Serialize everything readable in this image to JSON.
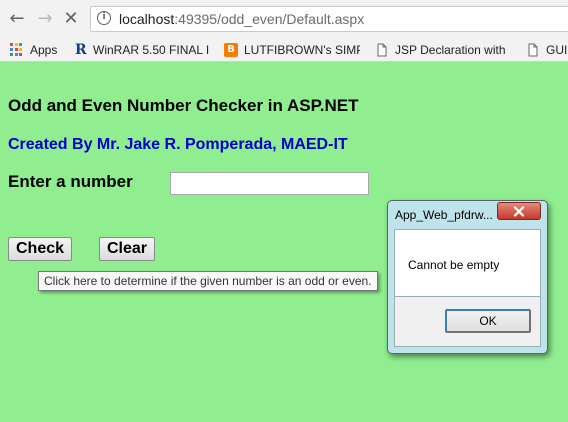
{
  "browser": {
    "url_host": "localhost",
    "url_rest": ":49395/odd_even/Default.aspx",
    "bookmarks": [
      {
        "label": "Apps"
      },
      {
        "label": "WinRAR 5.50 FINAL I"
      },
      {
        "label": "LUTFIBROWN's SIMP"
      },
      {
        "label": "JSP Declaration with"
      },
      {
        "label": "GUI"
      }
    ]
  },
  "page": {
    "title": "Odd and Even Number Checker in ASP.NET",
    "author": "Created By Mr. Jake R. Pomperada, MAED-IT",
    "input_label": "Enter a number",
    "input_value": "",
    "check_label": "Check",
    "clear_label": "Clear",
    "tooltip": "Click here to determine if the given number is an odd or even."
  },
  "dialog": {
    "title": "App_Web_pfdrw...",
    "message": "Cannot be empty",
    "ok_label": "OK"
  },
  "colors": {
    "page_bg": "#90ee90",
    "author_text": "#0000cd"
  }
}
